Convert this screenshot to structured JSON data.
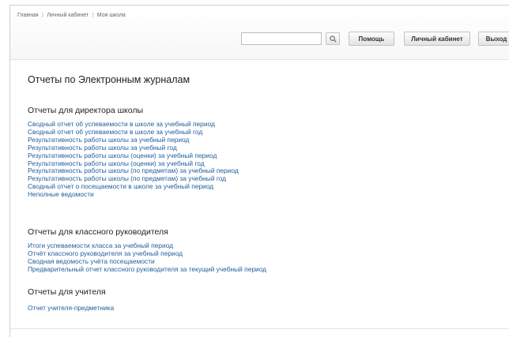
{
  "breadcrumb": {
    "items": [
      "Главная",
      "Личный кабинет",
      "Моя школа"
    ],
    "separator": "⟩"
  },
  "header": {
    "search_placeholder": "",
    "search_value": "",
    "buttons": {
      "help": "Помощь",
      "cabinet": "Личный кабинет",
      "logout": "Выход"
    }
  },
  "page": {
    "title": "Отчеты по Электронным журналам"
  },
  "sections": {
    "director": {
      "title": "Отчеты для директора школы",
      "links": [
        "Сводный отчет об успеваемости в школе за учебный период",
        "Сводный отчет об успеваемости в школе за учебный год",
        "Результативность работы школы за учебный период",
        "Результативность работы школы за учебный год",
        "Результативность работы школы (оценки) за учебный период",
        "Результативность работы школы (оценки) за учебный год",
        "Результативность работы школы (по предметам) за учебный период",
        "Результативность работы школы (по предметам) за учебный год",
        "Сводный отчет о посещаемости в школе за учебный период",
        "Неполные ведомости"
      ]
    },
    "class_teacher": {
      "title": "Отчеты для классного руководителя",
      "links": [
        "Итоги успеваемости класса за учебный период",
        "Отчёт классного руководителя за учебный период",
        "Сводная ведомость учёта посещаемости",
        "Предварительный отчет классного руководителя за текущий учебный период"
      ]
    },
    "teacher": {
      "title": "Отчеты для учителя",
      "links": [
        "Отчет учителя-предметника"
      ]
    }
  },
  "colors": {
    "link": "#1f5e9c",
    "text": "#222222",
    "border": "#cfcfcf"
  }
}
